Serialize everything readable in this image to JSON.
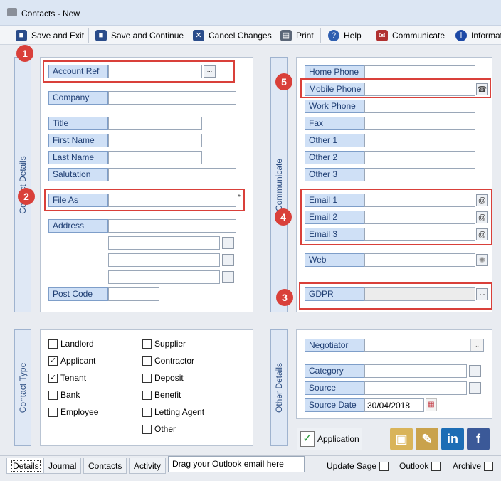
{
  "window": {
    "title": "Contacts  - New"
  },
  "toolbar": {
    "items": [
      {
        "label": "Save and Exit",
        "icon": "floppy-icon",
        "color": "#2a4c8a"
      },
      {
        "label": "Save and Continue",
        "icon": "floppy-icon",
        "color": "#2a4c8a"
      },
      {
        "label": "Cancel Changes",
        "icon": "floppy-cancel-icon",
        "color": "#2a4c8a"
      },
      {
        "label": "Print",
        "icon": "printer-icon",
        "color": "#5b6677"
      },
      {
        "label": "Help",
        "icon": "help-icon",
        "color": "#2f5fb0"
      },
      {
        "label": "Communicate",
        "icon": "communicate-icon",
        "color": "#b03030"
      },
      {
        "label": "Informati",
        "icon": "info-icon",
        "color": "#1d49a6"
      }
    ]
  },
  "contact_details": {
    "panel_label": "Contact Details",
    "account_ref": {
      "label": "Account Ref",
      "value": ""
    },
    "company": {
      "label": "Company",
      "value": ""
    },
    "title": {
      "label": "Title",
      "value": ""
    },
    "first_name": {
      "label": "First Name",
      "value": ""
    },
    "last_name": {
      "label": "Last Name",
      "value": ""
    },
    "salutation": {
      "label": "Salutation",
      "value": ""
    },
    "file_as": {
      "label": "File As",
      "value": "",
      "required_mark": "*"
    },
    "address": {
      "label": "Address",
      "lines": [
        "",
        "",
        "",
        ""
      ]
    },
    "post_code": {
      "label": "Post Code",
      "value": ""
    },
    "dots": "..."
  },
  "communicate": {
    "panel_label": "Communicate",
    "home_phone": {
      "label": "Home Phone",
      "value": ""
    },
    "mobile_phone": {
      "label": "Mobile Phone",
      "value": ""
    },
    "work_phone": {
      "label": "Work Phone",
      "value": ""
    },
    "fax": {
      "label": "Fax",
      "value": ""
    },
    "other1": {
      "label": "Other 1",
      "value": ""
    },
    "other2": {
      "label": "Other 2",
      "value": ""
    },
    "other3": {
      "label": "Other 3",
      "value": ""
    },
    "email1": {
      "label": "Email 1",
      "value": ""
    },
    "email2": {
      "label": "Email 2",
      "value": ""
    },
    "email3": {
      "label": "Email 3",
      "value": ""
    },
    "web": {
      "label": "Web",
      "value": ""
    },
    "gdpr": {
      "label": "GDPR",
      "value": ""
    },
    "at_glyph": "@",
    "dots": "..."
  },
  "badges": [
    "1",
    "2",
    "3",
    "4",
    "5"
  ],
  "contact_type": {
    "panel_label": "Contact Type",
    "left": [
      {
        "label": "Landlord",
        "checked": false
      },
      {
        "label": "Applicant",
        "checked": true
      },
      {
        "label": "Tenant",
        "checked": true
      },
      {
        "label": "Bank",
        "checked": false
      },
      {
        "label": "Employee",
        "checked": false
      }
    ],
    "right": [
      {
        "label": "Supplier",
        "checked": false
      },
      {
        "label": "Contractor",
        "checked": false
      },
      {
        "label": "Deposit",
        "checked": false
      },
      {
        "label": "Benefit",
        "checked": false
      },
      {
        "label": "Letting Agent",
        "checked": false
      },
      {
        "label": "Other",
        "checked": false
      }
    ]
  },
  "other_details": {
    "panel_label": "Other Details",
    "negotiator": {
      "label": "Negotiator",
      "value": ""
    },
    "category": {
      "label": "Category",
      "value": ""
    },
    "source": {
      "label": "Source",
      "value": ""
    },
    "source_date": {
      "label": "Source Date",
      "value": "30/04/2018"
    },
    "application_button": "Application",
    "social": [
      {
        "icon": "map-icon",
        "color": "#d9b45a"
      },
      {
        "icon": "map-pin-icon",
        "color": "#c9a24c"
      },
      {
        "icon": "linkedin-icon",
        "color": "#1c6db5",
        "text": "in"
      },
      {
        "icon": "facebook-icon",
        "color": "#3b5998",
        "text": "f"
      }
    ]
  },
  "bottom": {
    "tabs": [
      "Details",
      "Journal",
      "Contacts",
      "Activity"
    ],
    "drop_hint": "Drag your Outlook email here",
    "checks": [
      {
        "label": "Update Sage",
        "checked": false
      },
      {
        "label": "Outlook",
        "checked": false
      },
      {
        "label": "Archive",
        "checked": false
      }
    ]
  }
}
